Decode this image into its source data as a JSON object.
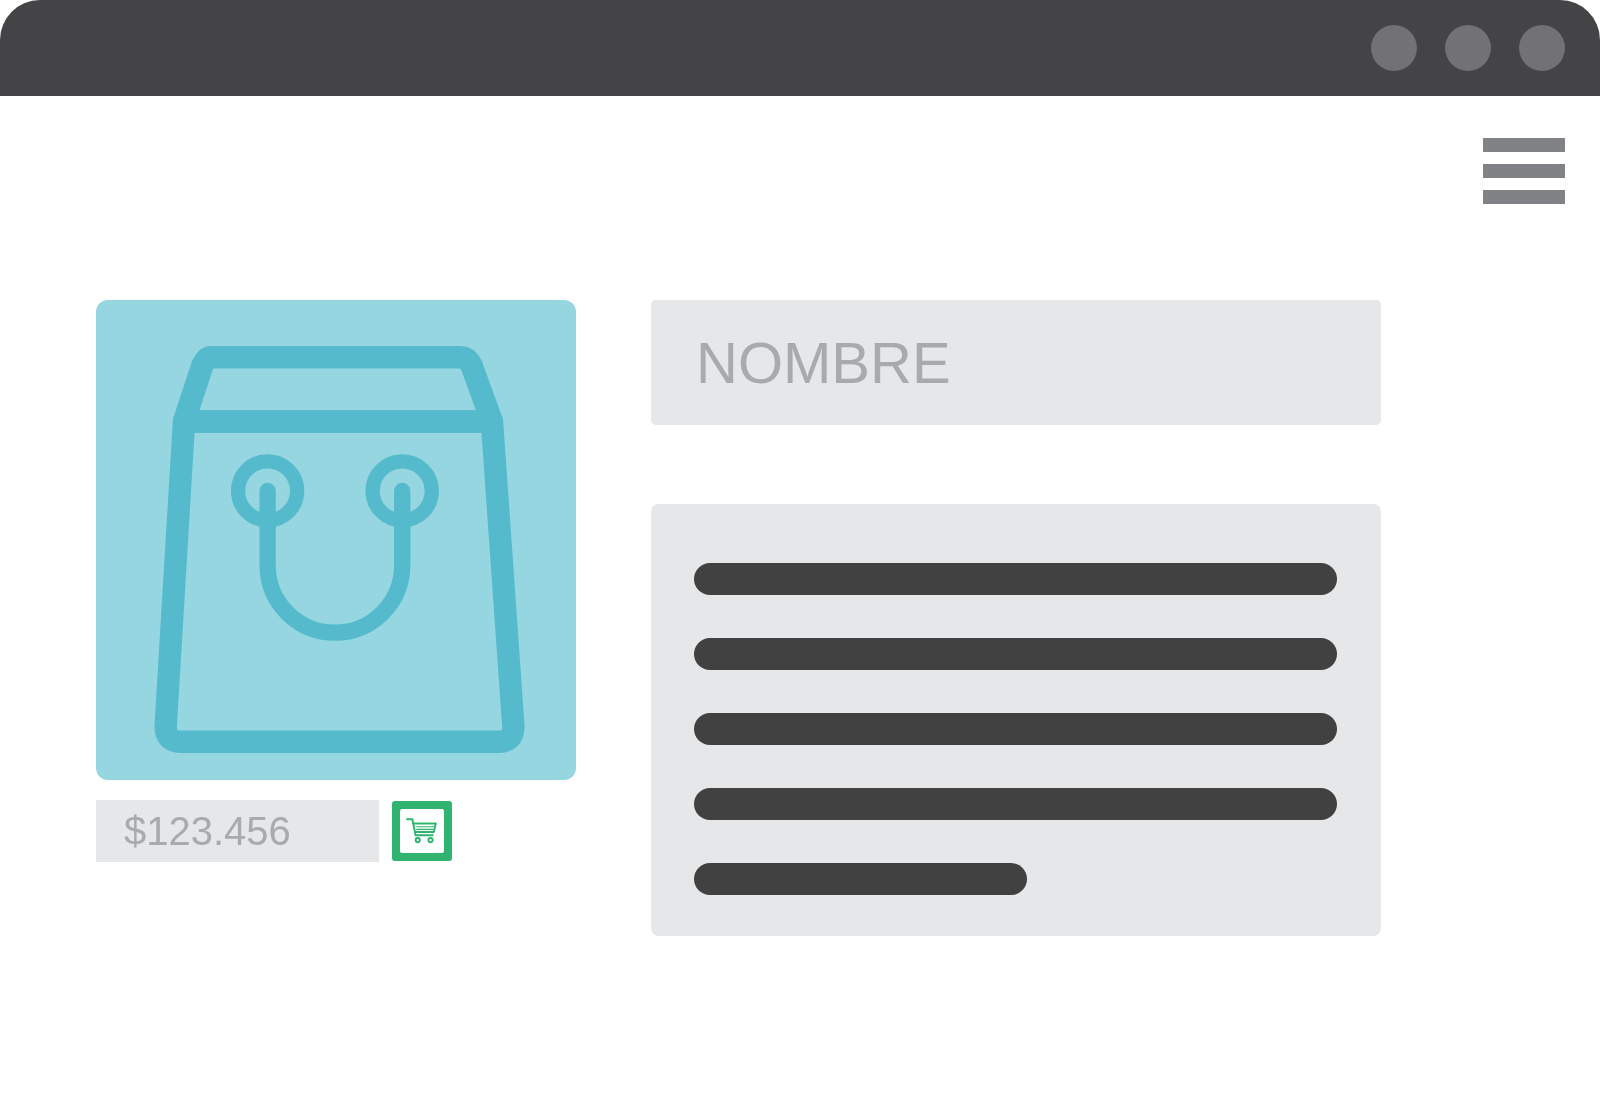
{
  "product": {
    "name_field": {
      "placeholder": "NOMBRE"
    },
    "price_field": {
      "placeholder": "$123.456"
    }
  }
}
